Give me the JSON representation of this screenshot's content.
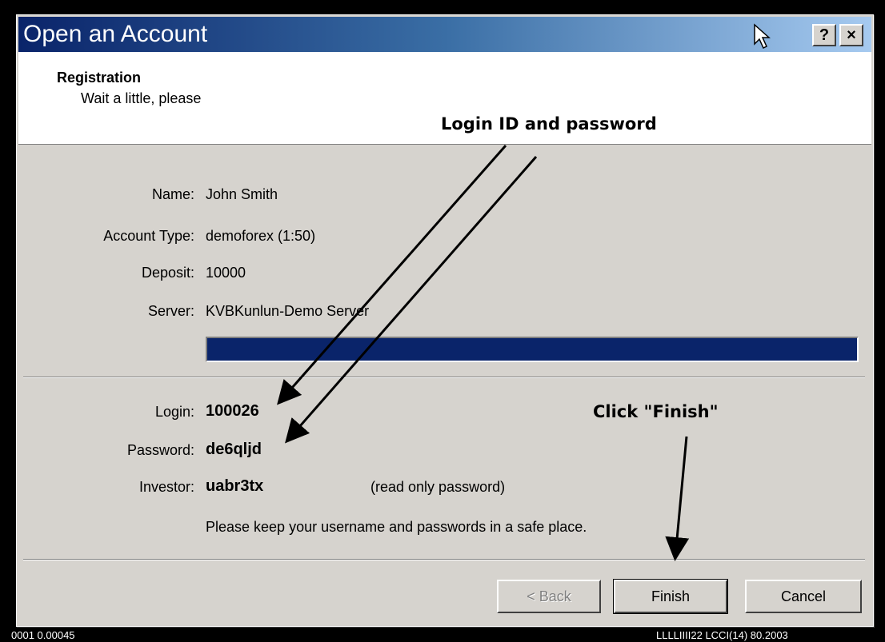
{
  "window": {
    "title": "Open an Account",
    "help_label": "?",
    "close_label": "×"
  },
  "header": {
    "title": "Registration",
    "subtitle": "Wait a little, please"
  },
  "info": {
    "name_label": "Name:",
    "name_value": "John Smith",
    "account_type_label": "Account Type:",
    "account_type_value": "demoforex (1:50)",
    "deposit_label": "Deposit:",
    "deposit_value": "10000",
    "server_label": "Server:",
    "server_value": "KVBKunlun-Demo Server"
  },
  "progress": {
    "percent": 100
  },
  "credentials": {
    "login_label": "Login:",
    "login_value": "100026",
    "password_label": "Password:",
    "password_value": "de6qljd",
    "investor_label": "Investor:",
    "investor_value": "uabr3tx",
    "investor_note": "(read only password)",
    "keep_safe_note": "Please keep your username and passwords in a safe place."
  },
  "buttons": {
    "back": "< Back",
    "finish": "Finish",
    "cancel": "Cancel"
  },
  "annotations": {
    "login_hint": "Login ID and password",
    "finish_hint": "Click \"Finish\""
  },
  "background": {
    "bottom_left_text": "0001  0.00045",
    "bottom_right_text": "LLLLIIII22  LCCI(14)  80.2003"
  }
}
